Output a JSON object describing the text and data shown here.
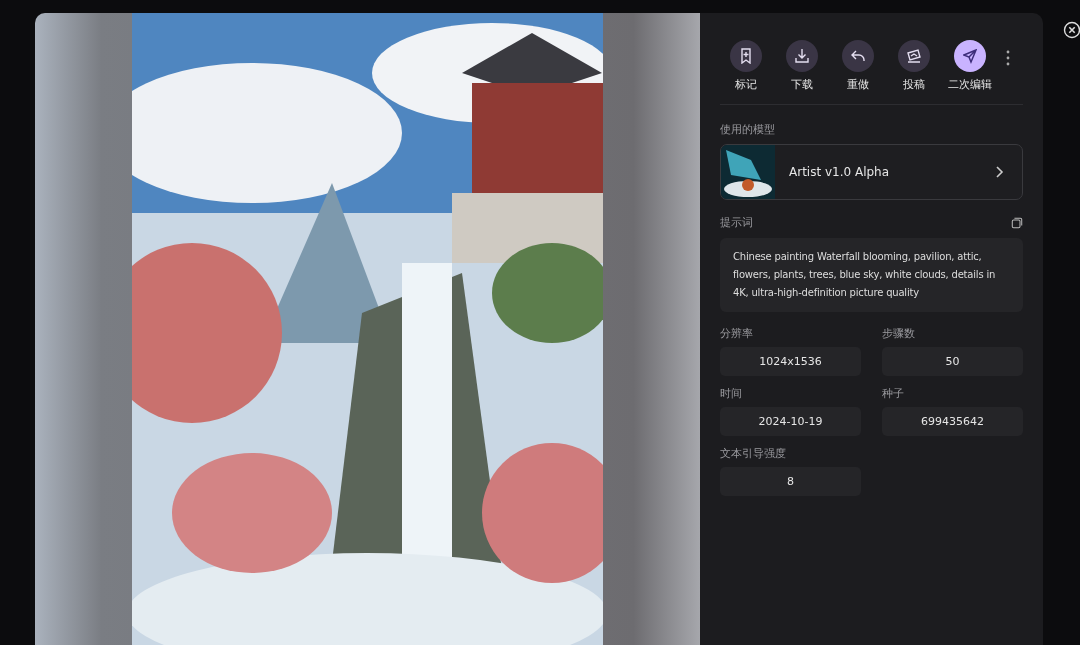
{
  "actions": [
    {
      "label": "标记",
      "selected": false
    },
    {
      "label": "下载",
      "selected": false
    },
    {
      "label": "重做",
      "selected": false
    },
    {
      "label": "投稿",
      "selected": false
    },
    {
      "label": "二次编辑",
      "selected": true
    }
  ],
  "model": {
    "label": "使用的模型",
    "name": "Artist v1.0 Alpha"
  },
  "prompt": {
    "label": "提示词",
    "text": "Chinese painting Waterfall blooming, pavilion, attic, flowers, plants, trees, blue sky, white clouds, details in 4K, ultra-high-definition picture quality"
  },
  "params": [
    {
      "label": "分辨率",
      "value": "1024x1536"
    },
    {
      "label": "步骤数",
      "value": "50"
    },
    {
      "label": "时间",
      "value": "2024-10-19"
    },
    {
      "label": "种子",
      "value": "699435642"
    },
    {
      "label": "文本引导强度",
      "value": "8"
    }
  ]
}
